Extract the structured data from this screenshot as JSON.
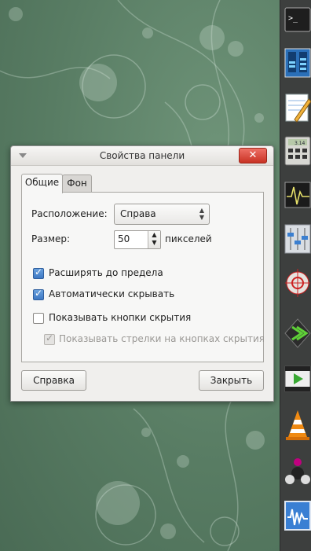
{
  "dialog": {
    "title": "Свойства панели",
    "close_symbol": "✕",
    "tabs": [
      {
        "label": "Общие",
        "active": true
      },
      {
        "label": "Фон",
        "active": false
      }
    ],
    "position_label": "Расположение:",
    "position_value": "Справа",
    "size_label": "Размер:",
    "size_value": "50",
    "size_unit": "пикселей",
    "options": [
      {
        "label": "Расширять до предела",
        "checked": true,
        "enabled": true
      },
      {
        "label": "Автоматически скрывать",
        "checked": true,
        "enabled": true
      },
      {
        "label": "Показывать кнопки скрытия",
        "checked": false,
        "enabled": true
      },
      {
        "label": "Показывать стрелки на кнопках скрытия",
        "checked": true,
        "enabled": false
      }
    ],
    "help_button": "Справка",
    "close_button": "Закрыть"
  },
  "side_panel": {
    "launchers": [
      {
        "icon": "terminal-icon",
        "screen_text": ">_"
      },
      {
        "icon": "system-monitor-icon"
      },
      {
        "icon": "notepad-icon"
      },
      {
        "icon": "calculator-icon",
        "screen_text": "3.14"
      },
      {
        "icon": "oscilloscope-icon"
      },
      {
        "icon": "mixer-icon"
      },
      {
        "icon": "target-icon"
      },
      {
        "icon": "arrow-forward-icon"
      },
      {
        "icon": "video-player-icon"
      },
      {
        "icon": "vlc-cone-icon"
      },
      {
        "icon": "molecule-icon"
      },
      {
        "icon": "waveform-icon"
      }
    ]
  },
  "colors": {
    "wallpaper": "#5c7f66",
    "panel": "#3d3f3e",
    "checkbox_active": "#3d78c4",
    "close_button": "#c83224"
  }
}
